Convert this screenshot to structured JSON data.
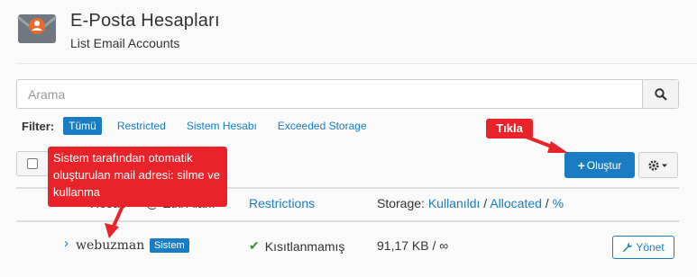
{
  "header": {
    "title": "E-Posta Hesapları",
    "subtitle": "List Email Accounts",
    "icon": "email-account-icon"
  },
  "search": {
    "placeholder": "Arama",
    "button_icon": "search-icon"
  },
  "filter": {
    "label": "Filter:",
    "options": [
      "Tümü",
      "Restricted",
      "Sistem Hesabı",
      "Exceeded Storage"
    ],
    "active": "Tümü"
  },
  "toolbar": {
    "create_label": "Oluştur",
    "create_icon": "plus-icon",
    "settings_icon": "gear-icon"
  },
  "columns": {
    "account": "Hesap",
    "domain": "@ Etki Alanı",
    "restrictions": "Restrictions",
    "storage_prefix": "Storage:",
    "storage_used": "Kullanıldı",
    "storage_allocated": "Allocated",
    "storage_percent": "%",
    "separator": " / "
  },
  "rows": [
    {
      "account": "webuzman",
      "badge": "Sistem",
      "restriction": "Kısıtlanmamış",
      "storage": "91,17 KB / ∞",
      "manage_label": "Yönet",
      "manage_icon": "wrench-icon"
    }
  ],
  "annotations": {
    "click_label": "Tıkla",
    "note": "Sistem tarafından otomatik oluşturulan mail adresi: silme ve kullanma",
    "color": "#e8232a"
  },
  "colors": {
    "accent": "#1a7dc4",
    "annotation": "#e8232a",
    "success": "#3a8e3a"
  }
}
